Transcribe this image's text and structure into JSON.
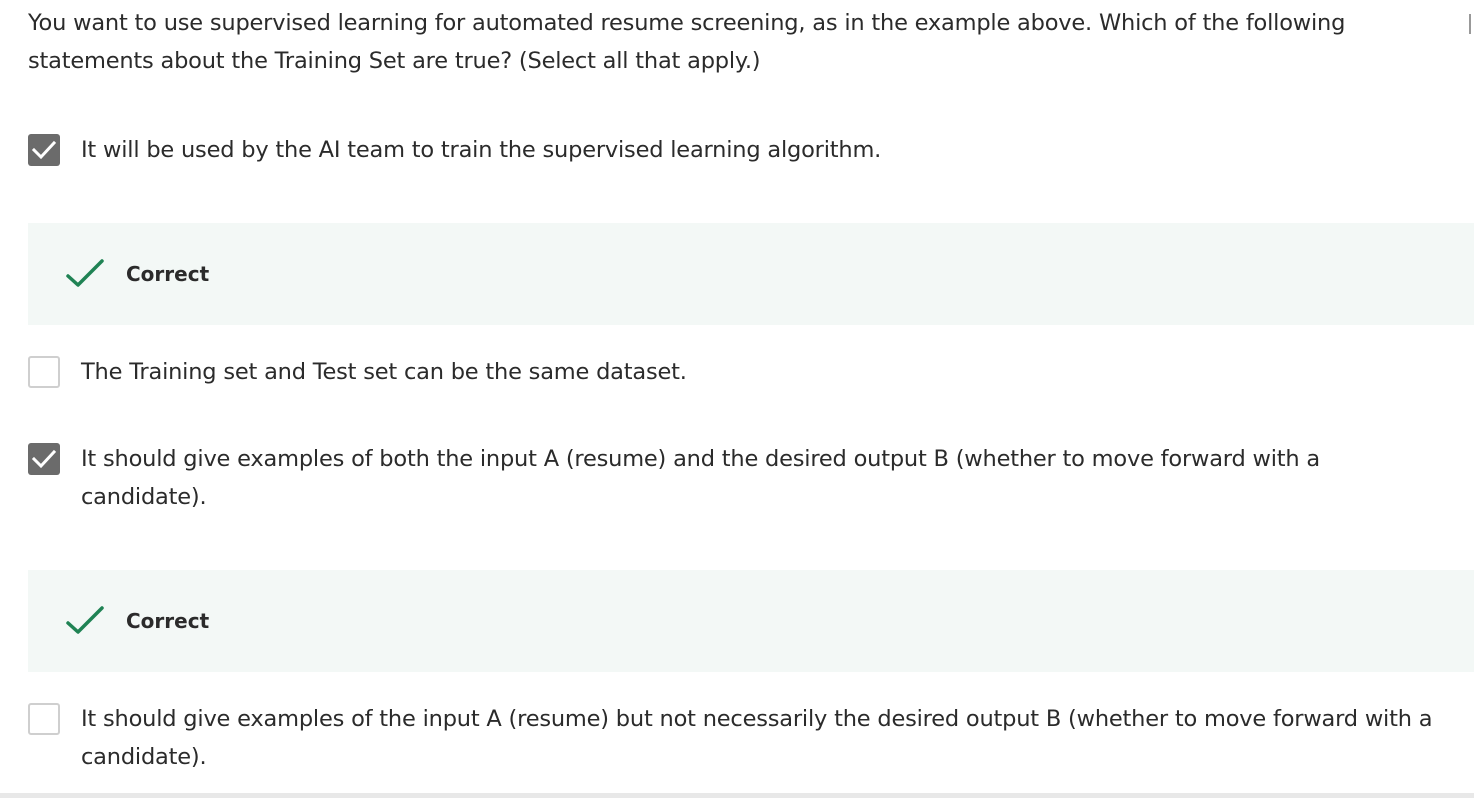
{
  "question": {
    "text": "You want to use supervised learning for automated resume screening, as in the example above. Which of the following statements about the Training Set are true? (Select all that apply.)"
  },
  "options": [
    {
      "text": "It will be used by the AI team to train the supervised learning algorithm.",
      "checked": true,
      "feedback": "Correct"
    },
    {
      "text": "The Training set and Test set can be the same dataset.",
      "checked": false
    },
    {
      "text": "It should give examples of both the input A (resume) and the desired output B (whether to move forward with a candidate).",
      "checked": true,
      "feedback": "Correct"
    },
    {
      "text": "It should give examples of the input A (resume) but not necessarily the desired output B (whether to move forward with a candidate).",
      "checked": false
    }
  ],
  "colors": {
    "correct_green": "#1f8354",
    "checkbox_checked": "#6b6b6b",
    "feedback_background": "#f3f8f6"
  },
  "icons": {
    "checked": "checkmark-icon",
    "correct": "correct-check-icon"
  }
}
